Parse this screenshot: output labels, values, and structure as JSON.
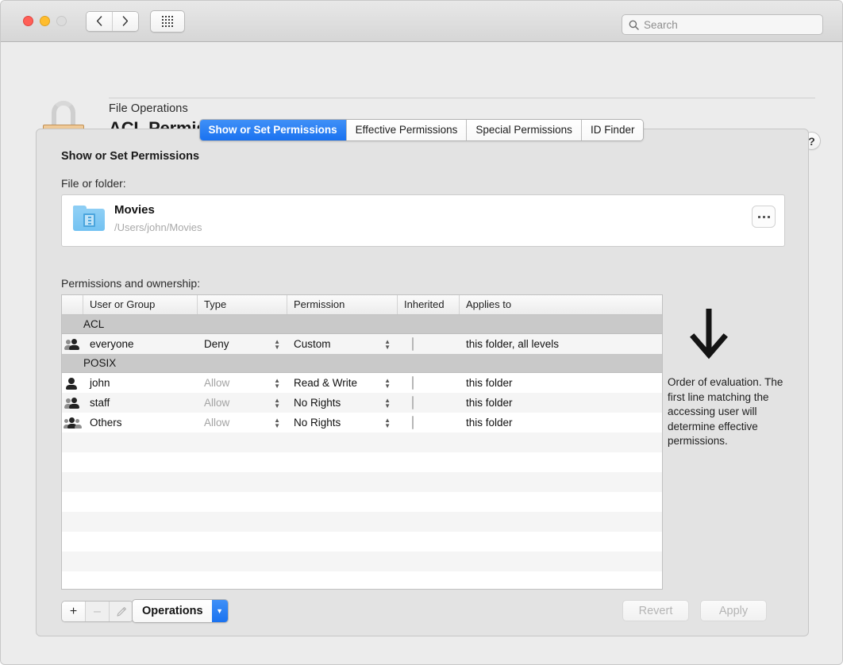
{
  "window": {
    "traffic_lights": [
      "close",
      "minimize",
      "zoom"
    ],
    "nav_back": "‹",
    "nav_forward": "›",
    "grid_icon": "grid-icon"
  },
  "search": {
    "placeholder": "Search",
    "value": ""
  },
  "header": {
    "subtitle": "File Operations",
    "title": "ACL Permissions",
    "help_label": "?",
    "lock_icon": "padlock-icon"
  },
  "tabs": [
    {
      "label": "Show or Set Permissions",
      "active": true
    },
    {
      "label": "Effective Permissions",
      "active": false
    },
    {
      "label": "Special Permissions",
      "active": false
    },
    {
      "label": "ID Finder",
      "active": false
    }
  ],
  "main": {
    "section_title": "Show or Set Permissions",
    "file_label": "File or folder:",
    "file": {
      "name": "Movies",
      "path": "/Users/john/Movies",
      "icon": "movies-folder-icon",
      "browse_label": "…"
    },
    "perms_label": "Permissions and ownership:",
    "table": {
      "columns": [
        "",
        "User or Group",
        "Type",
        "Permission",
        "Inherited",
        "Applies to"
      ],
      "groups": [
        {
          "name": "ACL",
          "rows": [
            {
              "icon": "group-icon",
              "user": "everyone",
              "type": "Deny",
              "type_dim": false,
              "permission": "Custom",
              "inherited": false,
              "applies_to": "this folder, all levels"
            }
          ]
        },
        {
          "name": "POSIX",
          "rows": [
            {
              "icon": "user-icon",
              "user": "john",
              "type": "Allow",
              "type_dim": true,
              "permission": "Read & Write",
              "inherited": false,
              "applies_to": "this folder"
            },
            {
              "icon": "group-icon",
              "user": "staff",
              "type": "Allow",
              "type_dim": true,
              "permission": "No Rights",
              "inherited": false,
              "applies_to": "this folder"
            },
            {
              "icon": "others-icon",
              "user": "Others",
              "type": "Allow",
              "type_dim": true,
              "permission": "No Rights",
              "inherited": false,
              "applies_to": "this folder"
            }
          ]
        }
      ]
    },
    "side_note": {
      "arrow_icon": "down-arrow-icon",
      "text": "Order of evaluation. The first line matching the accessing user will determine effective permissions."
    }
  },
  "footer": {
    "add_label": "+",
    "remove_label": "–",
    "edit_label": "edit-pencil-icon",
    "operations_label": "Operations",
    "operations_arrow": "▼",
    "revert_label": "Revert",
    "apply_label": "Apply"
  },
  "colors": {
    "accent": "#1a72f0",
    "window_bg": "#ececec",
    "panel_bg": "#e3e3e3",
    "group_header_bg": "#c9c9c9",
    "folder_blue": "#73c2f2",
    "lock_tan": "#e9bd84"
  }
}
